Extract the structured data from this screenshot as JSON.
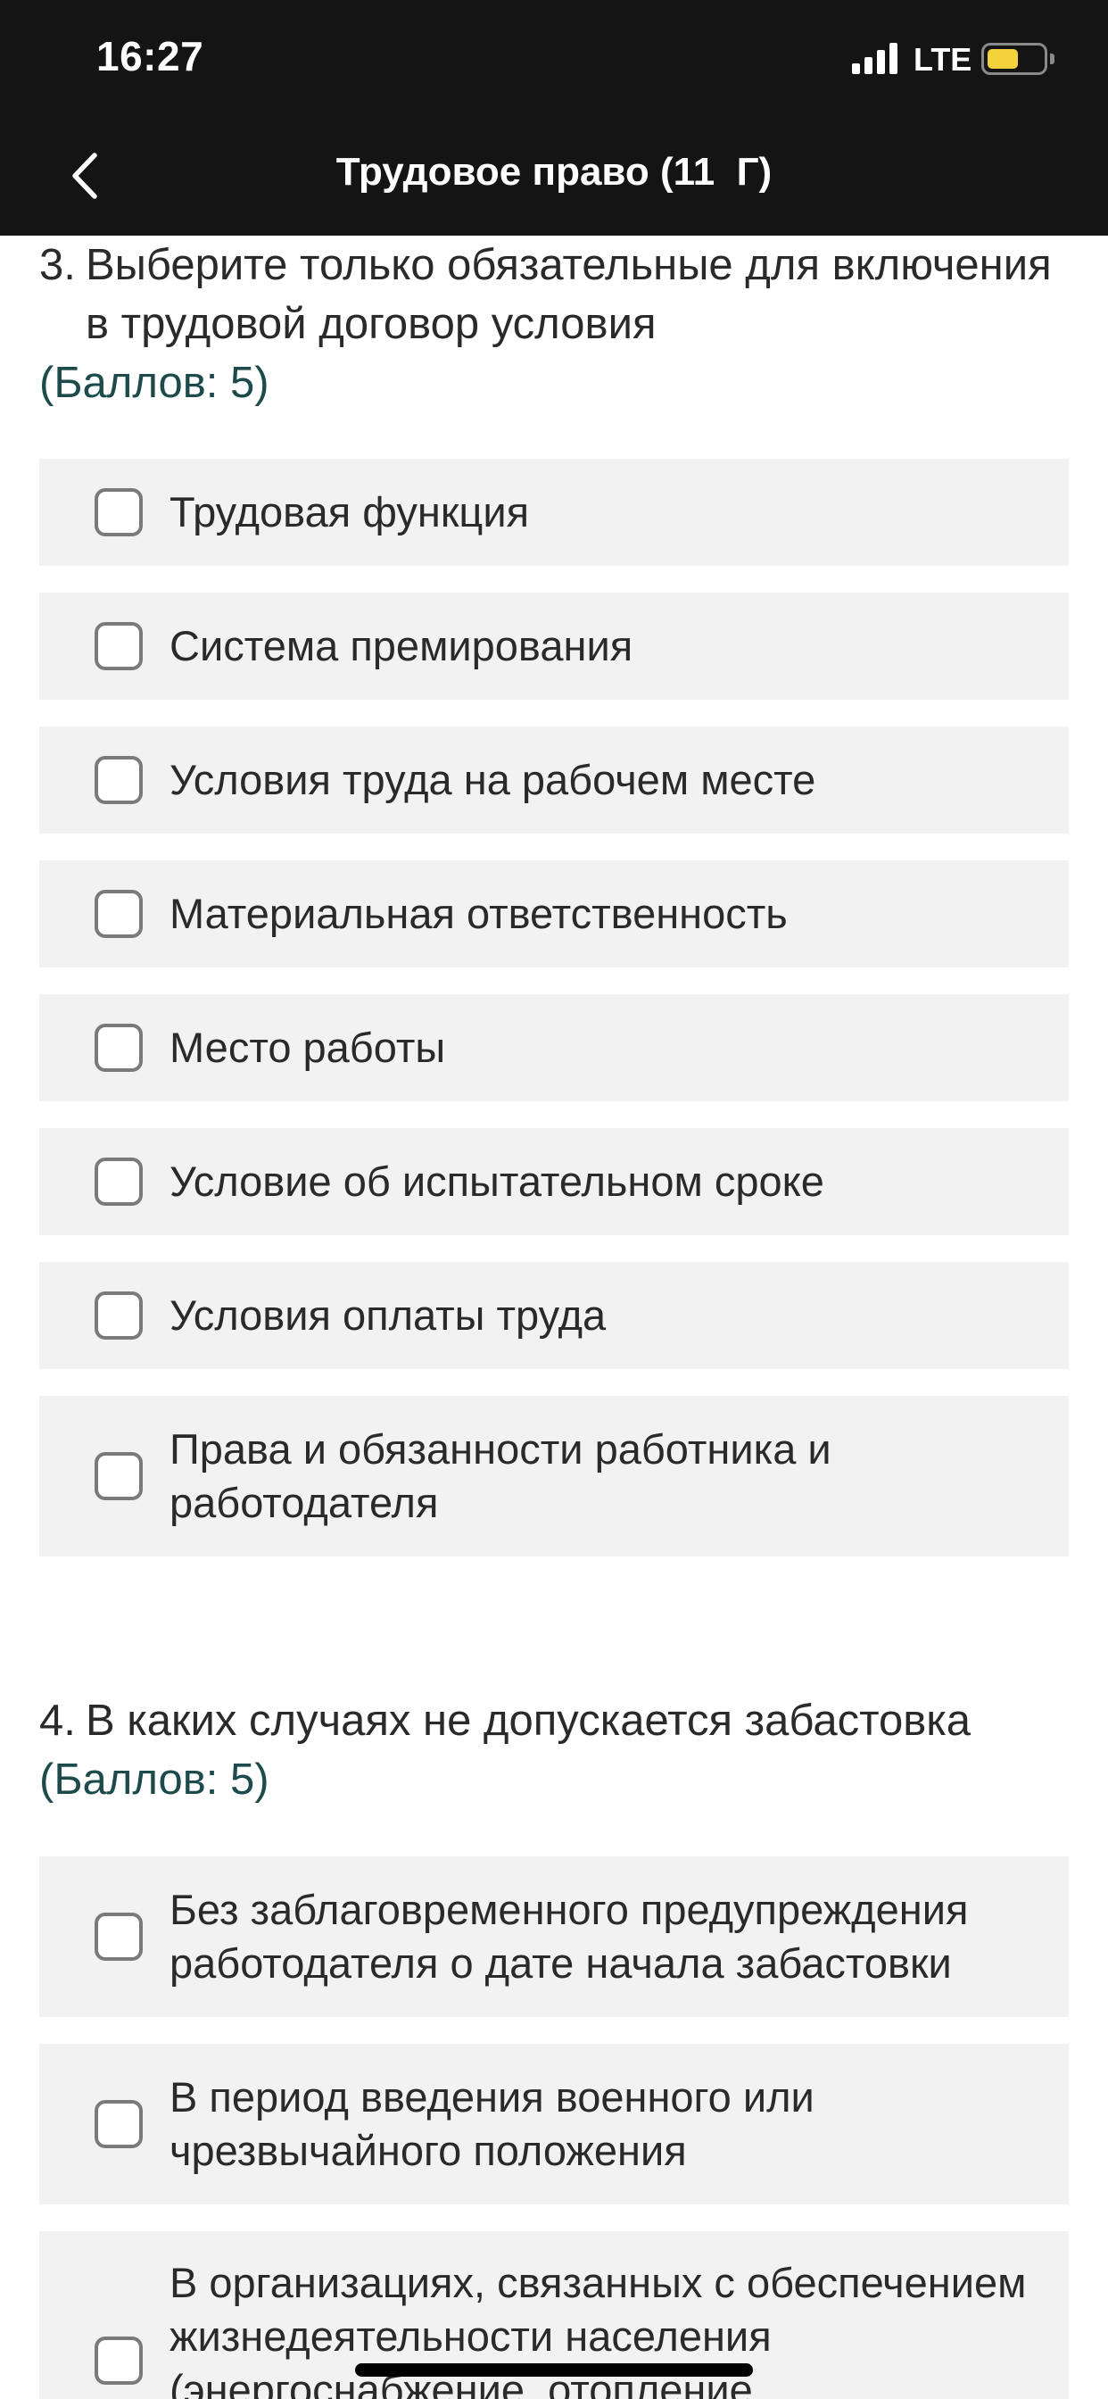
{
  "status_bar": {
    "time": "16:27",
    "network": "LTE",
    "battery_level": 0.55,
    "signal_bars": 4,
    "colors": {
      "background": "#141414",
      "battery_fill": "#f4d23c"
    }
  },
  "nav": {
    "back_icon": "chevron-left-icon",
    "title": "Трудовое право (11  Г)"
  },
  "questions": [
    {
      "number": "3.",
      "text": "Выберите только обязательные для включения в трудовой договор условия",
      "points": "(Баллов: 5)",
      "options": [
        {
          "label": "Трудовая функция",
          "checked": false
        },
        {
          "label": "Система премирования",
          "checked": false
        },
        {
          "label": "Условия труда на рабочем месте",
          "checked": false
        },
        {
          "label": "Материальная ответственность",
          "checked": false
        },
        {
          "label": "Место работы",
          "checked": false
        },
        {
          "label": "Условие об испытательном сроке",
          "checked": false
        },
        {
          "label": "Условия оплаты труда",
          "checked": false
        },
        {
          "label": "Права и обязанности работника и работодателя",
          "checked": false
        }
      ]
    },
    {
      "number": "4.",
      "text": "В каких случаях не допускается забастовка",
      "points": "(Баллов: 5)",
      "options": [
        {
          "label": "Без заблаговременного предупреждения работодателя о дате начала забастовки",
          "checked": false
        },
        {
          "label": "В период введения военного или чрезвычайного положения",
          "checked": false
        },
        {
          "label": "В организациях, связанных с обеспечением жизнедеятельности населения (энергоснабжение, отопление",
          "checked": false
        }
      ]
    }
  ],
  "colors": {
    "points_text": "#1d4a4a",
    "option_background": "#f2f2f2",
    "checkbox_border": "#7a7a7a"
  }
}
